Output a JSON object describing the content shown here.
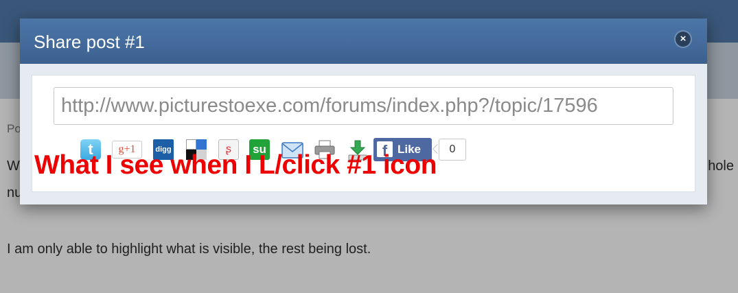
{
  "background": {
    "fragment_po": "Po",
    "fragment_w": "W",
    "fragment_nu": "nu",
    "fragment_hole": "hole",
    "line": "I am only able to highlight what is visible, the rest being lost."
  },
  "modal": {
    "title": "Share post #1",
    "close_icon": "×",
    "url_value": "http://www.picturestoexe.com/forums/index.php?/topic/17596"
  },
  "share_icons": [
    {
      "name": "twitter-icon",
      "glyph": "t"
    },
    {
      "name": "google-plus-icon",
      "glyph": "g+1"
    },
    {
      "name": "digg-icon",
      "glyph": "digg"
    },
    {
      "name": "delicious-icon",
      "glyph": ""
    },
    {
      "name": "stumbleupon-plain-icon",
      "glyph": "ʂ"
    },
    {
      "name": "stumbleupon-icon",
      "glyph": "su"
    },
    {
      "name": "email-icon",
      "glyph": ""
    },
    {
      "name": "print-icon",
      "glyph": ""
    },
    {
      "name": "download-icon",
      "glyph": ""
    }
  ],
  "facebook": {
    "like_label": "Like",
    "icon": "f",
    "count": "0"
  },
  "annotation": "What I see when I L/click #1 icon",
  "colors": {
    "header_blue": "#4c76a8",
    "annotation_red": "#ee0000",
    "facebook_blue": "#4e69a2"
  }
}
